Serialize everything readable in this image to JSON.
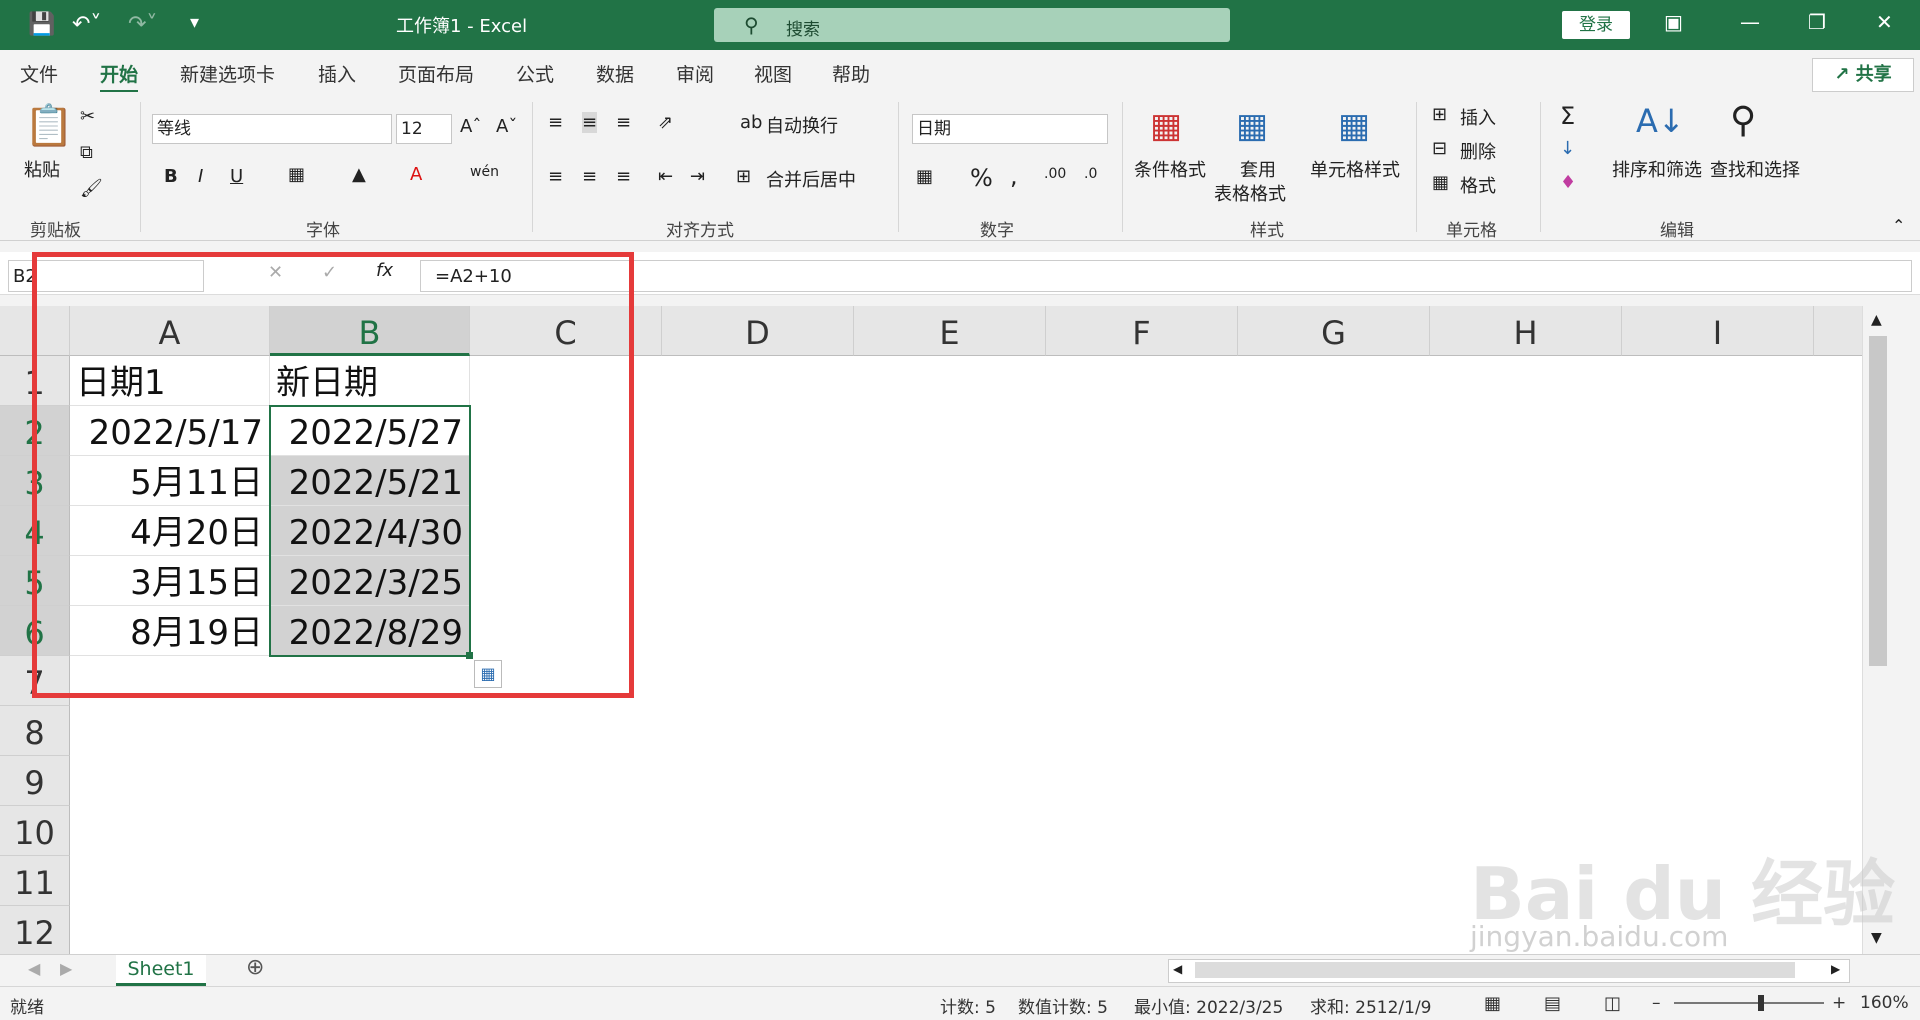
{
  "app": {
    "doc_title": "工作簿1  -  Excel",
    "search_placeholder": "搜索",
    "login_label": "登录",
    "share_label": "共享"
  },
  "menu": [
    "文件",
    "开始",
    "新建选项卡",
    "插入",
    "页面布局",
    "公式",
    "数据",
    "审阅",
    "视图",
    "帮助"
  ],
  "ribbon": {
    "paste_label": "粘贴",
    "clipboard_label": "剪贴板",
    "font_name": "等线",
    "font_size": "12",
    "font_label": "字体",
    "wrap_label": "自动换行",
    "merge_label": "合并后居中",
    "align_label": "对齐方式",
    "number_format": "日期",
    "number_label": "数字",
    "cond_format_label": "条件格式",
    "table_format_label_1": "套用",
    "table_format_label_2": "表格格式",
    "cell_style_label": "单元格样式",
    "styles_label": "样式",
    "insert_label": "插入",
    "delete_label": "删除",
    "format_label": "格式",
    "cells_label": "单元格",
    "sort_label": "排序和筛选",
    "find_label": "查找和选择",
    "edit_label": "编辑"
  },
  "formula_bar": {
    "name_box": "B2",
    "formula": "=A2+10",
    "fx": "fx"
  },
  "columns": [
    "A",
    "B",
    "C",
    "D",
    "E",
    "F",
    "G",
    "H",
    "I"
  ],
  "rows": [
    "1",
    "2",
    "3",
    "4",
    "5",
    "6",
    "7",
    "8",
    "9",
    "10",
    "11",
    "12"
  ],
  "cells": {
    "A1": "日期1",
    "B1": "新日期",
    "A2": "2022/5/17",
    "B2": "2022/5/27",
    "A3": "5月11日",
    "B3": "2022/5/21",
    "A4": "4月20日",
    "B4": "2022/4/30",
    "A5": "3月15日",
    "B5": "2022/3/25",
    "A6": "8月19日",
    "B6": "2022/8/29"
  },
  "sheet_tab": "Sheet1",
  "status": {
    "ready": "就绪",
    "count": "计数: 5",
    "numeric_count": "数值计数: 5",
    "min": "最小值: 2022/3/25",
    "sum": "求和: 2512/1/9",
    "zoom": "160%"
  },
  "watermark": {
    "brand": "Bai du 经验",
    "url": "jingyan.baidu.com"
  },
  "colors": {
    "accent": "#217346",
    "annotation": "#e53a3a"
  }
}
